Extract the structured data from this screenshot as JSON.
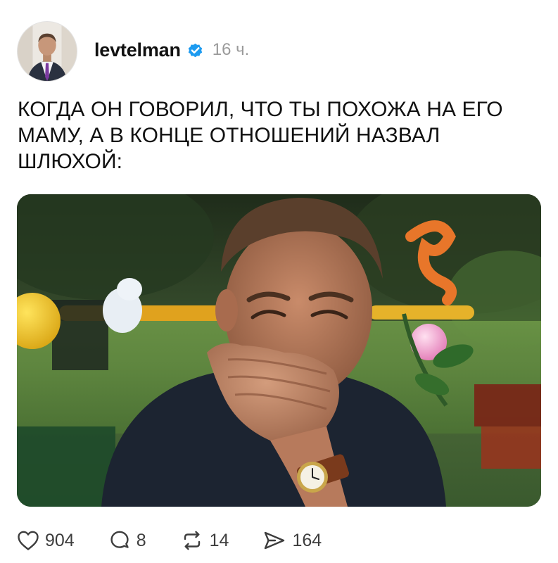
{
  "post": {
    "author": {
      "username": "levtelman",
      "avatar_icon": "profile-photo-avatar",
      "verified_icon": "verified-badge-icon",
      "verified_color": "#1d9bf0",
      "timestamp": "16 ч."
    },
    "text": "КОГДА ОН ГОВОРИЛ, ЧТО ТЫ ПОХОЖА НА ЕГО\nМАМУ, А В КОНЦЕ ОТНОШЕНИЙ НАЗВАЛ\nШЛЮХОЙ:",
    "media": {
      "description_icon": "meme-image-man-laughing-covering-mouth"
    },
    "actions": {
      "likes": {
        "icon": "heart-icon",
        "count": "904"
      },
      "replies": {
        "icon": "comment-icon",
        "count": "8"
      },
      "reposts": {
        "icon": "repost-icon",
        "count": "14"
      },
      "shares": {
        "icon": "send-icon",
        "count": "164"
      }
    }
  }
}
